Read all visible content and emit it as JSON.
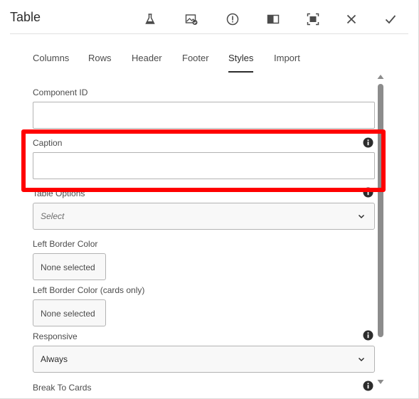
{
  "dialog": {
    "title": "Table",
    "header_icons": [
      "flask-icon",
      "image-check-icon",
      "alert-circle-icon",
      "panel-toggle-icon",
      "fullscreen-icon",
      "close-icon",
      "check-icon"
    ]
  },
  "tabs": [
    {
      "label": "Columns",
      "active": false
    },
    {
      "label": "Rows",
      "active": false
    },
    {
      "label": "Header",
      "active": false
    },
    {
      "label": "Footer",
      "active": false
    },
    {
      "label": "Styles",
      "active": true
    },
    {
      "label": "Import",
      "active": false
    }
  ],
  "form": {
    "component_id": {
      "label": "Component ID",
      "value": ""
    },
    "caption": {
      "label": "Caption",
      "value": ""
    },
    "table_options": {
      "label": "Table Options",
      "selected": "Select"
    },
    "left_border_color": {
      "label": "Left Border Color",
      "value": "None selected"
    },
    "left_border_color_cards": {
      "label": "Left Border Color (cards only)",
      "value": "None selected"
    },
    "responsive": {
      "label": "Responsive",
      "selected": "Always"
    },
    "break_to_cards": {
      "label": "Break To Cards"
    }
  },
  "highlight": {
    "color": "#ff0000"
  }
}
